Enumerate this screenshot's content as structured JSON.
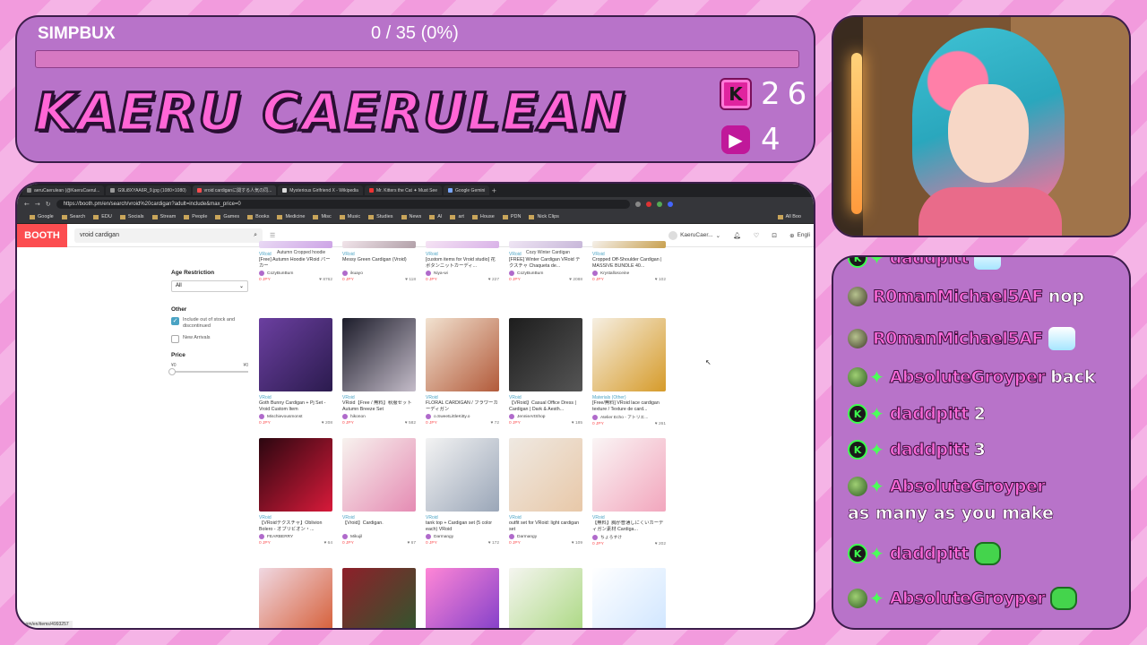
{
  "overlay": {
    "goal_label": "SIMPBUX",
    "goal_count": "0 / 35 (0%)",
    "goal_progress": 0,
    "streamer_name": "KAERU CAERULEAN",
    "stat_k_icon": "k-icon",
    "stat_k_value": "26",
    "stat_v_icon": "play-icon",
    "stat_v_value": "4",
    "accent_color": "#ff66d6",
    "panel_color": "#b873c9"
  },
  "browser": {
    "tabs": [
      {
        "label": "aeruCaerulean (@KaeruCaerul..."
      },
      {
        "label": "G9Li8XYAA6R_9.jpg (1080×1080)"
      },
      {
        "label": "vroid cardiganに関する人気の同..."
      },
      {
        "label": "Mysterious Girlfriend X - Wikipedia"
      },
      {
        "label": "Mr. Kitters the Cat ✦ Must See"
      },
      {
        "label": "Google Gemini"
      }
    ],
    "url": "https://booth.pm/en/search/vroid%20cardigan?adult=include&max_price=0",
    "bookmarks": [
      "Google",
      "Search",
      "EDU",
      "Socials",
      "Stream",
      "People",
      "Games",
      "Books",
      "Medicine",
      "Misc",
      "Music",
      "Studies",
      "News",
      "AI",
      "art",
      "House",
      "PDN",
      "Nick Clips"
    ],
    "all_bookmarks": "All Boo",
    "status_url": "th.pm/en/items/4993257"
  },
  "booth": {
    "logo": "BOOTH",
    "search_value": "vroid cardigan",
    "user": "KaeruCaer...",
    "lang": "Engli",
    "sidebar": {
      "age_heading": "Age Restriction",
      "age_value": "All",
      "other_heading": "Other",
      "include_out_of_stock": "Include out of stock and discontinued",
      "new_arrivals": "New Arrivals",
      "price_heading": "Price",
      "price_min": "¥0",
      "price_max": "¥0"
    },
    "row0_captions": [
      "Autumn Cropped hoodie",
      "Cozy Winter Cardigan"
    ],
    "items": [
      {
        "cat": "VRoid",
        "title": "[Free] Autumn Hoodie VRoid パーカー",
        "shop": "CozyBunBum",
        "price": "0 JPY",
        "likes": "8762"
      },
      {
        "cat": "VRoid",
        "title": "Messy Green Cardigan (Vroid)",
        "shop": "ikuayo",
        "price": "0 JPY",
        "likes": "118"
      },
      {
        "cat": "VRoid",
        "title": "[custom items for Vroid studio] 花ボタンニットカーディ...",
        "shop": "Niya-wi",
        "price": "0 JPY",
        "likes": "227"
      },
      {
        "cat": "VRoid",
        "title": "[FREE] Winter Cardigan VRoid テクスチャ Chaqueta de...",
        "shop": "CozyBunBum",
        "price": "0 JPY",
        "likes": "2088"
      },
      {
        "cat": "VRoid",
        "title": "Cropped Off-Shoulder Cardigan | MASSIVE BUNDLE 40...",
        "shop": "Krystallosceine",
        "price": "0 JPY",
        "likes": "102"
      },
      {
        "cat": "VRoid",
        "title": "Goth Bunny Cardigan + Pj Set - Vroid Custom Item",
        "shop": "Mischievousmonst",
        "price": "0 JPY",
        "likes": "208"
      },
      {
        "cat": "VRoid",
        "title": "VRoid【Free / 無料】秋服セット Autumn Breeze Set",
        "shop": "hikonon",
        "price": "0 JPY",
        "likes": "582"
      },
      {
        "cat": "VRoid",
        "title": "FLORAL CARDIGAN / フラワーカーディガン",
        "shop": "o.SweetLittleKitty.o",
        "price": "0 JPY",
        "likes": "72"
      },
      {
        "cat": "VRoid",
        "title": "【VRoid】Casual Office Dress | Cardigan | Dark & Aesth...",
        "shop": "JennieArtShop",
        "price": "0 JPY",
        "likes": "185"
      },
      {
        "cat": "Materials (Other)",
        "title": "[Free/無料] VRoid lace cardigan texture / Texture de card...",
        "shop": "Atelier Echo - アトリエ...",
        "price": "0 JPY",
        "likes": "261"
      },
      {
        "cat": "VRoid",
        "title": "【VRoidテクスチャ】Oblivion Bolero - オブリビオン・...",
        "shop": "FEARBERRY",
        "price": "0 JPY",
        "likes": "64"
      },
      {
        "cat": "VRoid",
        "title": "【Vroid】Cardigan.",
        "shop": "Mikujil",
        "price": "0 JPY",
        "likes": "67"
      },
      {
        "cat": "VRoid",
        "title": "tank top + Cardigan set (5 color each) VRoid",
        "shop": "Darmangy",
        "price": "0 JPY",
        "likes": "172"
      },
      {
        "cat": "VRoid",
        "title": "outfit set for VRoid: light cardigan set",
        "shop": "Darmangy",
        "price": "0 JPY",
        "likes": "109"
      },
      {
        "cat": "VRoid",
        "title": "【無料】胸が普通しにくいカーディガン素材 Cardiga...",
        "shop": "ちょろすけ",
        "price": "0 JPY",
        "likes": "202"
      }
    ]
  },
  "chat": [
    {
      "user": "daddpitt",
      "badge": "k",
      "sparkle": true,
      "text": "",
      "emote": "anime"
    },
    {
      "user": "R0manMichael5AF",
      "badge": "r",
      "sparkle": false,
      "text": "nop",
      "emote": ""
    },
    {
      "user": "R0manMichael5AF",
      "badge": "r",
      "sparkle": false,
      "text": "",
      "emote": "anime"
    },
    {
      "user": "AbsoluteGroyper",
      "badge": "av",
      "sparkle": true,
      "text": "back",
      "emote": ""
    },
    {
      "user": "daddpitt",
      "badge": "k",
      "sparkle": true,
      "text": "2",
      "emote": ""
    },
    {
      "user": "daddpitt",
      "badge": "k",
      "sparkle": true,
      "text": "3",
      "emote": ""
    },
    {
      "user": "AbsoluteGroyper",
      "badge": "av",
      "sparkle": true,
      "text": "",
      "emote": "",
      "continuation": "as many as you make"
    },
    {
      "user": "daddpitt",
      "badge": "k",
      "sparkle": true,
      "text": "",
      "emote": "green"
    },
    {
      "user": "AbsoluteGroyper",
      "badge": "av",
      "sparkle": true,
      "text": "",
      "emote": "green"
    }
  ]
}
